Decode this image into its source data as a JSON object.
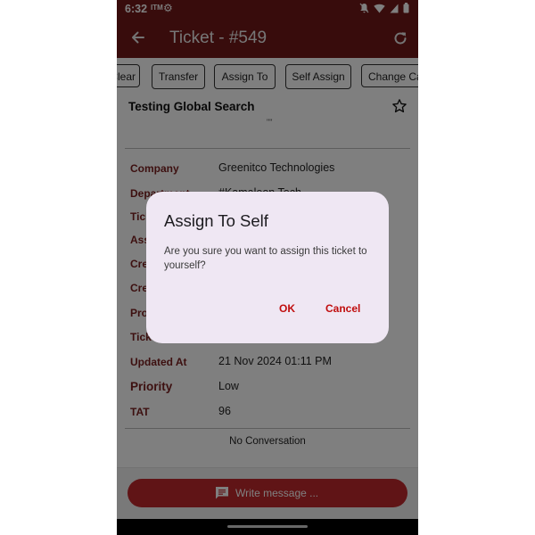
{
  "status_bar": {
    "time": "6:32",
    "carrier_badge": "ITM"
  },
  "app_bar": {
    "title": "Ticket - #549"
  },
  "actions": [
    {
      "label": "Clear"
    },
    {
      "label": "Transfer"
    },
    {
      "label": "Assign To"
    },
    {
      "label": "Self Assign"
    },
    {
      "label": "Change Category"
    }
  ],
  "ticket": {
    "subject": "Testing Global Search",
    "quote": "\"\"",
    "fields": [
      {
        "label": "Company",
        "value": "Greenitco Technologies"
      },
      {
        "label": "Department",
        "value": "#Kamaleon Tech"
      },
      {
        "label": "Ticket Type",
        "value": ""
      },
      {
        "label": "Assigned To",
        "value": ""
      },
      {
        "label": "Created By",
        "value": ""
      },
      {
        "label": "Created At",
        "value": ""
      },
      {
        "label": "Product",
        "value": ""
      },
      {
        "label": "Ticket Status",
        "value": ""
      },
      {
        "label": "Updated At",
        "value": "21 Nov 2024 01:11 PM"
      },
      {
        "label": "Priority",
        "value": "Low"
      },
      {
        "label": "TAT",
        "value": "96"
      }
    ],
    "no_conversation": "No Conversation"
  },
  "footer": {
    "write_label": "Write message ..."
  },
  "dialog": {
    "title": "Assign To Self",
    "message": "Are you sure you want to assign this ticket to yourself?",
    "ok_label": "OK",
    "cancel_label": "Cancel"
  },
  "colors": {
    "primary": "#701818",
    "accent_button": "#c0282d",
    "dialog_bg": "#efe7f3",
    "dialog_action": "#c00d0d"
  }
}
